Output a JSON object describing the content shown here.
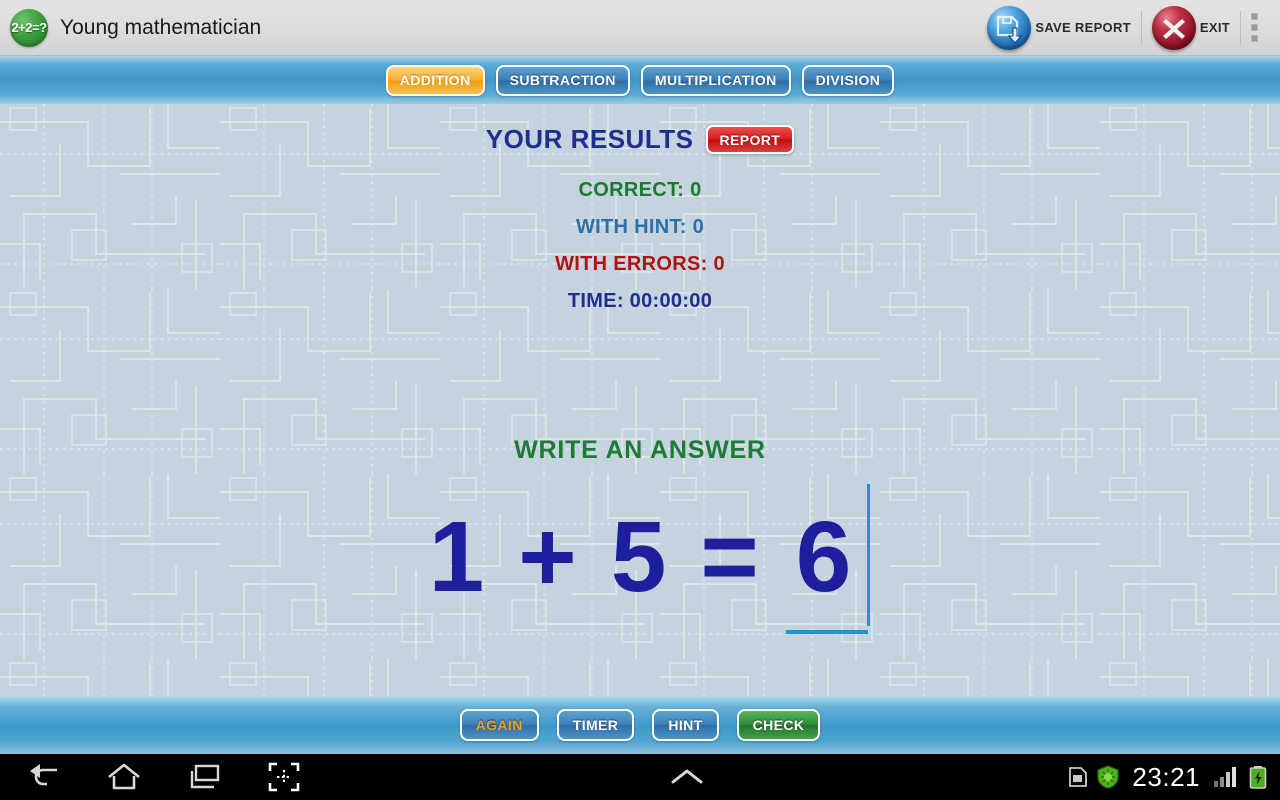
{
  "titlebar": {
    "app_icon_text": "2+2=?",
    "app_title": "Young mathematician",
    "save_report_label": "SAVE REPORT",
    "exit_label": "EXIT",
    "save_icon": "save-floppy-download-icon",
    "exit_icon": "close-x-circle-icon",
    "overflow_icon": "overflow-menu-icon",
    "bar_color": "#dedede"
  },
  "tabs": [
    {
      "label": "ADDITION",
      "active": true
    },
    {
      "label": "SUBTRACTION",
      "active": false
    },
    {
      "label": "MULTIPLICATION",
      "active": false
    },
    {
      "label": "DIVISION",
      "active": false
    }
  ],
  "tab_colors": {
    "active_bg": "#f6ae33",
    "inactive_bg": "#3b7fb8",
    "border": "#ffffff"
  },
  "results": {
    "title": "YOUR RESULTS",
    "report_button": "REPORT",
    "report_color": "#d61b1b",
    "stats": [
      {
        "label": "CORRECT: 0",
        "color": "#1c7a2e"
      },
      {
        "label": "WITH HINT: 0",
        "color": "#2d6fa8"
      },
      {
        "label": "WITH ERRORS: 0",
        "color": "#b01212"
      },
      {
        "label": "TIME: 00:00:00",
        "color": "#1f2f8f"
      }
    ]
  },
  "exercise": {
    "prompt": "WRITE AN ANSWER",
    "prompt_color": "#1f7a33",
    "left_operand": "1",
    "operator": "+",
    "equals": "=",
    "answer": "6",
    "equation_color": "#1f1f9e",
    "caret_color": "#2196ce"
  },
  "actions": [
    {
      "label": "AGAIN",
      "style": "amber-text"
    },
    {
      "label": "TIMER",
      "style": "blue"
    },
    {
      "label": "HINT",
      "style": "blue"
    },
    {
      "label": "CHECK",
      "style": "green"
    }
  ],
  "statusbar": {
    "back_icon": "back-arrow-icon",
    "home_icon": "home-icon",
    "recents_icon": "recent-apps-icon",
    "screenshot_icon": "shrink-screen-icon",
    "expand_icon": "chevron-up-icon",
    "sim_icon": "sim-card-icon",
    "shield_icon": "antivirus-shield-icon",
    "clock": "23:21",
    "signal_icon": "signal-bars-icon",
    "battery_icon": "battery-charging-icon"
  }
}
